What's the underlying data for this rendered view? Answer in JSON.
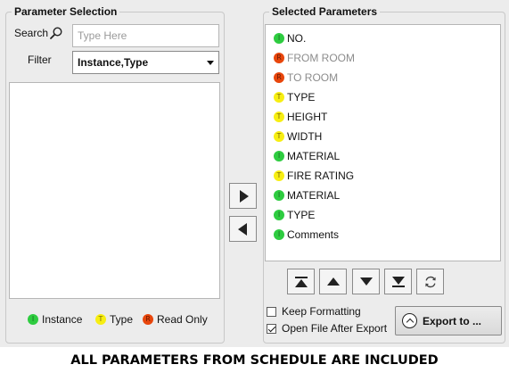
{
  "param_selection": {
    "title": "Parameter Selection",
    "search_label": "Search",
    "search_icon": "magnifier-icon",
    "search_placeholder": "Type Here",
    "search_value": "",
    "filter_label": "Filter",
    "filter_value": "Instance,Type",
    "available_items": []
  },
  "legend": {
    "instance": {
      "badge": "I",
      "label": "Instance",
      "color": "#2ecc40"
    },
    "type": {
      "badge": "T",
      "label": "Type",
      "color": "#f7ee12"
    },
    "readonly": {
      "badge": "R",
      "label": "Read Only",
      "color": "#e8460c"
    }
  },
  "move_buttons": {
    "add_icon": "triangle-right-icon",
    "remove_icon": "triangle-left-icon"
  },
  "selected": {
    "title": "Selected Parameters",
    "items": [
      {
        "badge": "I",
        "kind": "instance",
        "label": "NO."
      },
      {
        "badge": "R",
        "kind": "readonly",
        "label": "FROM ROOM"
      },
      {
        "badge": "R",
        "kind": "readonly",
        "label": "TO ROOM"
      },
      {
        "badge": "T",
        "kind": "type",
        "label": "TYPE"
      },
      {
        "badge": "T",
        "kind": "type",
        "label": "HEIGHT"
      },
      {
        "badge": "T",
        "kind": "type",
        "label": "WIDTH"
      },
      {
        "badge": "I",
        "kind": "instance",
        "label": "MATERIAL"
      },
      {
        "badge": "T",
        "kind": "type",
        "label": "FIRE RATING"
      },
      {
        "badge": "I",
        "kind": "instance",
        "label": "MATERIAL"
      },
      {
        "badge": "I",
        "kind": "instance",
        "label": "TYPE"
      },
      {
        "badge": "I",
        "kind": "instance",
        "label": "Comments"
      }
    ]
  },
  "order_buttons": [
    "move-top-icon",
    "move-up-icon",
    "move-down-icon",
    "move-bottom-icon",
    "refresh-icon"
  ],
  "options": {
    "keep_formatting": {
      "label": "Keep Formatting",
      "checked": false
    },
    "open_after_export": {
      "label": "Open File After Export",
      "checked": true
    }
  },
  "export_button": {
    "label": "Export to ...",
    "icon": "chevron-up-circle-icon"
  },
  "caption": "ALL PARAMETERS FROM SCHEDULE ARE INCLUDED"
}
